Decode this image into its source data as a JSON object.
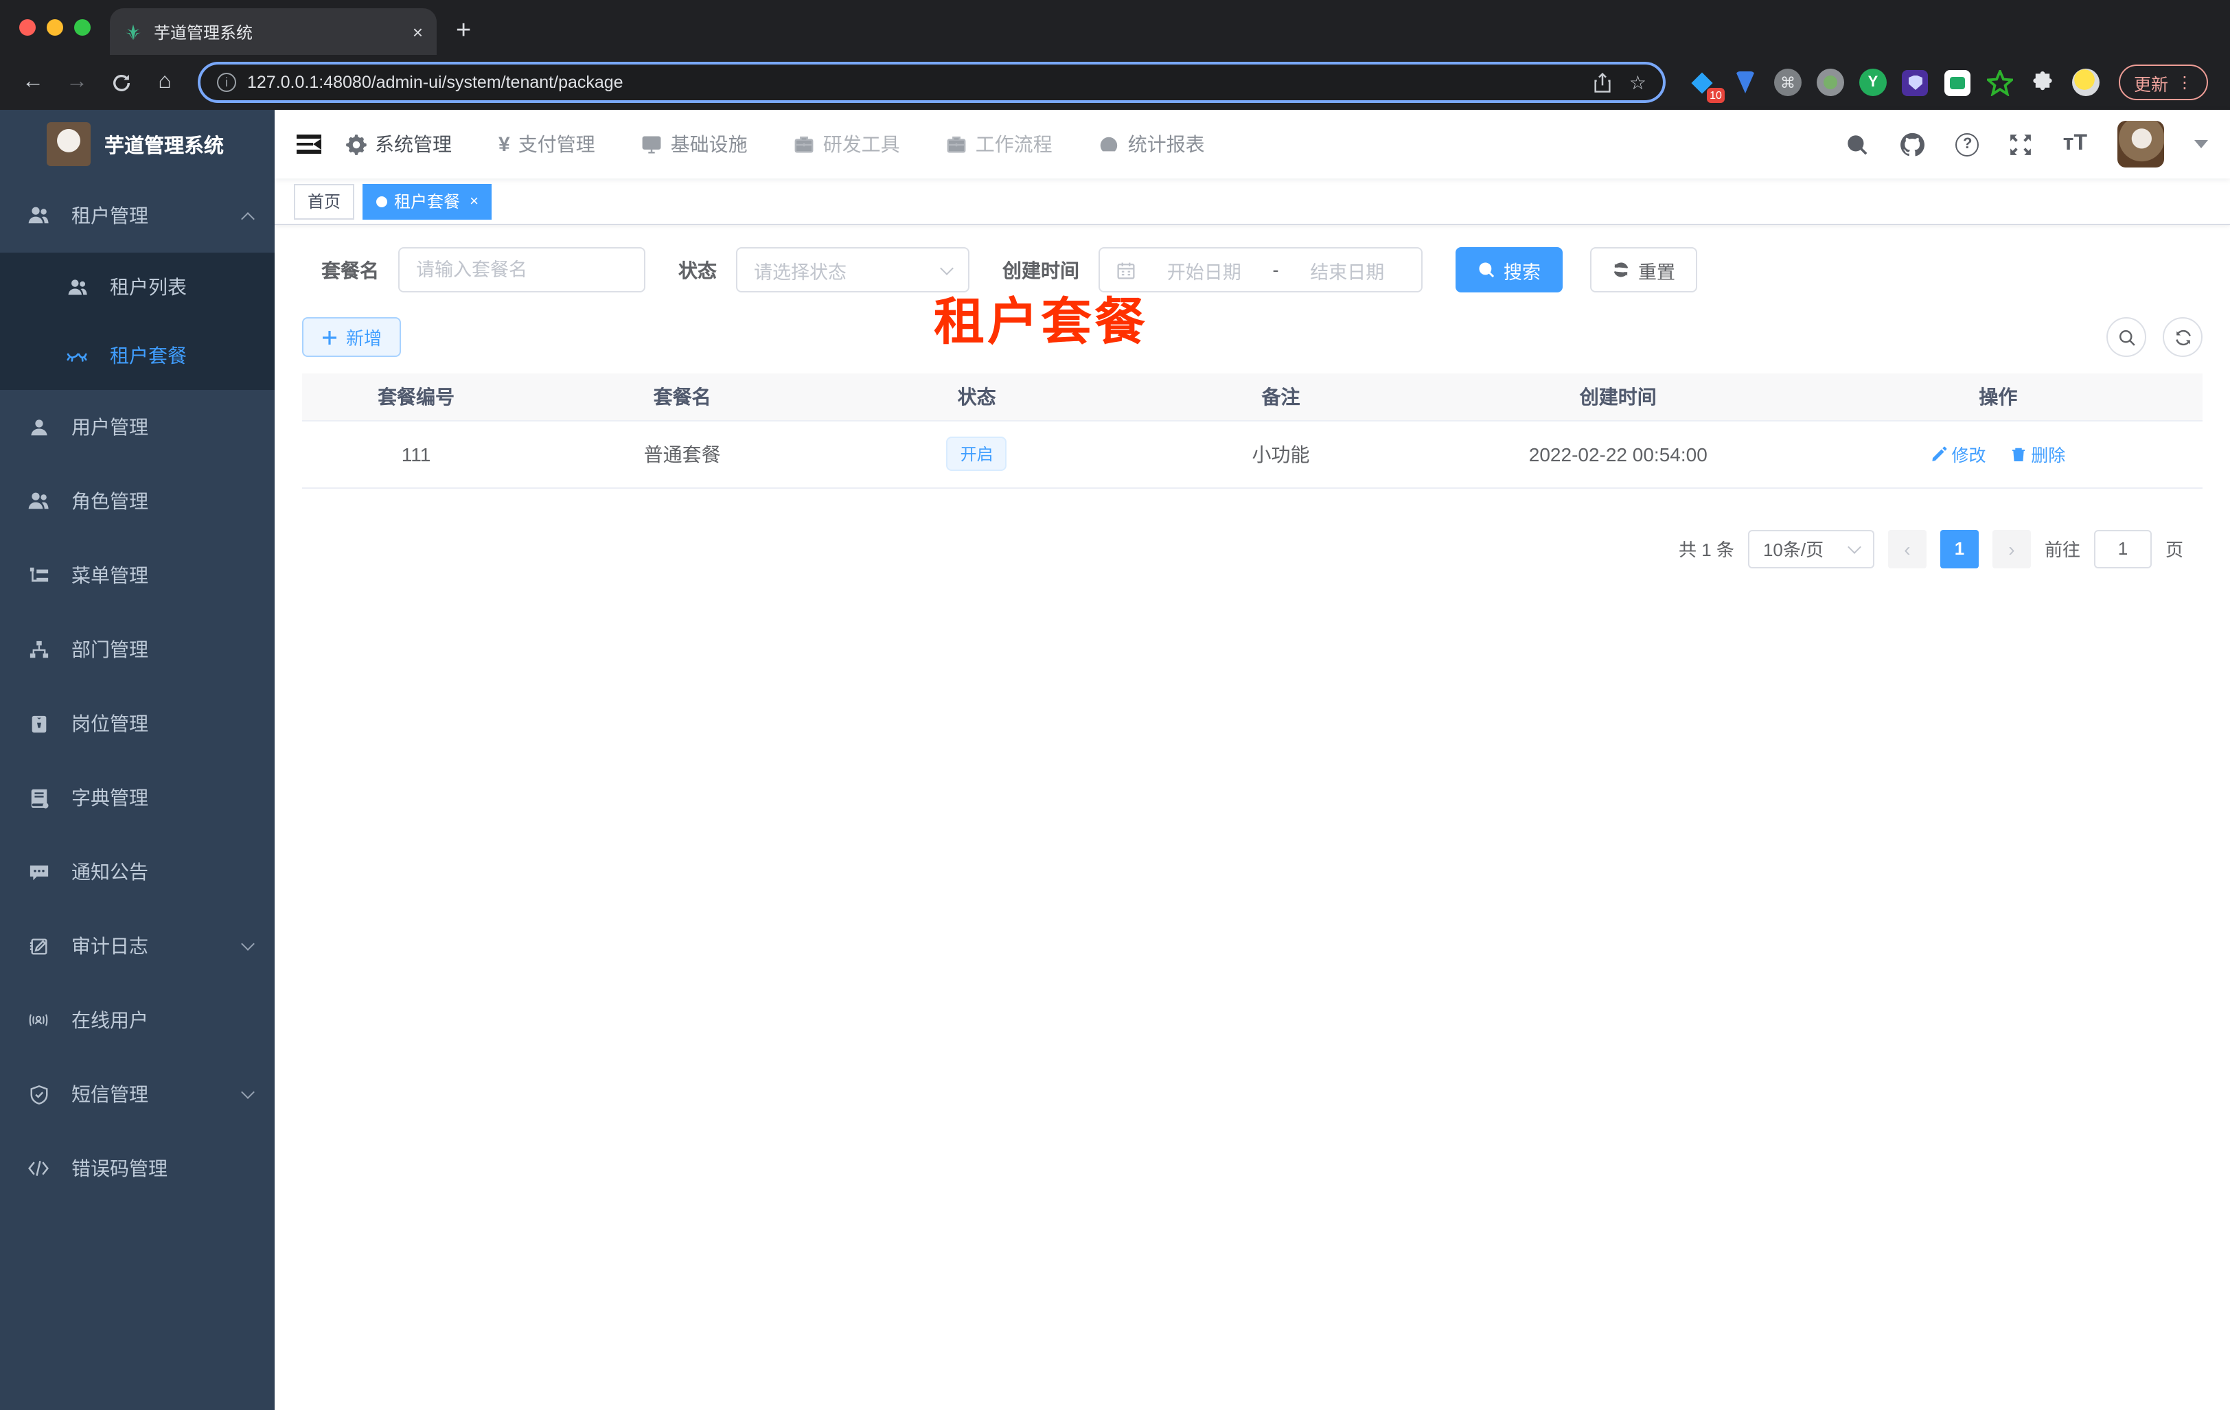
{
  "browser": {
    "tab_title": "芋道管理系统",
    "tab_close": "×",
    "new_tab": "+",
    "back": "←",
    "forward": "→",
    "home": "⌂",
    "url": "127.0.0.1:48080/admin-ui/system/tenant/package",
    "star": "☆",
    "ext_badge": "10",
    "ext_cmd": "⌘",
    "ext_y": "Y",
    "update_label": "更新",
    "menu_dots": "⋮",
    "traffic": {
      "close": "#ff5f57",
      "min": "#febc2e",
      "max": "#33c748"
    }
  },
  "header": {
    "menus": [
      "系统管理",
      "支付管理",
      "基础设施",
      "研发工具",
      "工作流程",
      "统计报表"
    ],
    "help": "?",
    "font_size": "тT"
  },
  "sidebar": {
    "title": "芋道管理系统",
    "parent": "租户管理",
    "submenu": [
      "租户列表",
      "租户套餐"
    ],
    "items": [
      "用户管理",
      "角色管理",
      "菜单管理",
      "部门管理",
      "岗位管理",
      "字典管理",
      "通知公告",
      "审计日志",
      "在线用户",
      "短信管理",
      "错误码管理"
    ]
  },
  "tags": {
    "home": "首页",
    "active": "租户套餐",
    "close": "×"
  },
  "watermark": "租户套餐",
  "filters": {
    "name_label": "套餐名",
    "name_placeholder": "请输入套餐名",
    "status_label": "状态",
    "status_placeholder": "请选择状态",
    "date_label": "创建时间",
    "date_start": "开始日期",
    "date_sep": "-",
    "date_end": "结束日期",
    "search": "搜索",
    "reset": "重置"
  },
  "toolbar": {
    "add": "新增"
  },
  "table": {
    "headers": [
      "套餐编号",
      "套餐名",
      "状态",
      "备注",
      "创建时间",
      "操作"
    ],
    "rows": [
      {
        "id": "111",
        "name": "普通套餐",
        "status": "开启",
        "remark": "小功能",
        "created": "2022-02-22 00:54:00",
        "edit": "修改",
        "delete": "删除"
      }
    ]
  },
  "pagination": {
    "total": "共 1 条",
    "per_page": "10条/页",
    "prev": "‹",
    "page": "1",
    "next": "›",
    "goto": "前往",
    "goto_value": "1",
    "unit": "页"
  },
  "colors": {
    "accent": "#409eff",
    "watermark": "#ff3100",
    "sidebar": "#304156",
    "submenu": "#1f2d3d"
  }
}
